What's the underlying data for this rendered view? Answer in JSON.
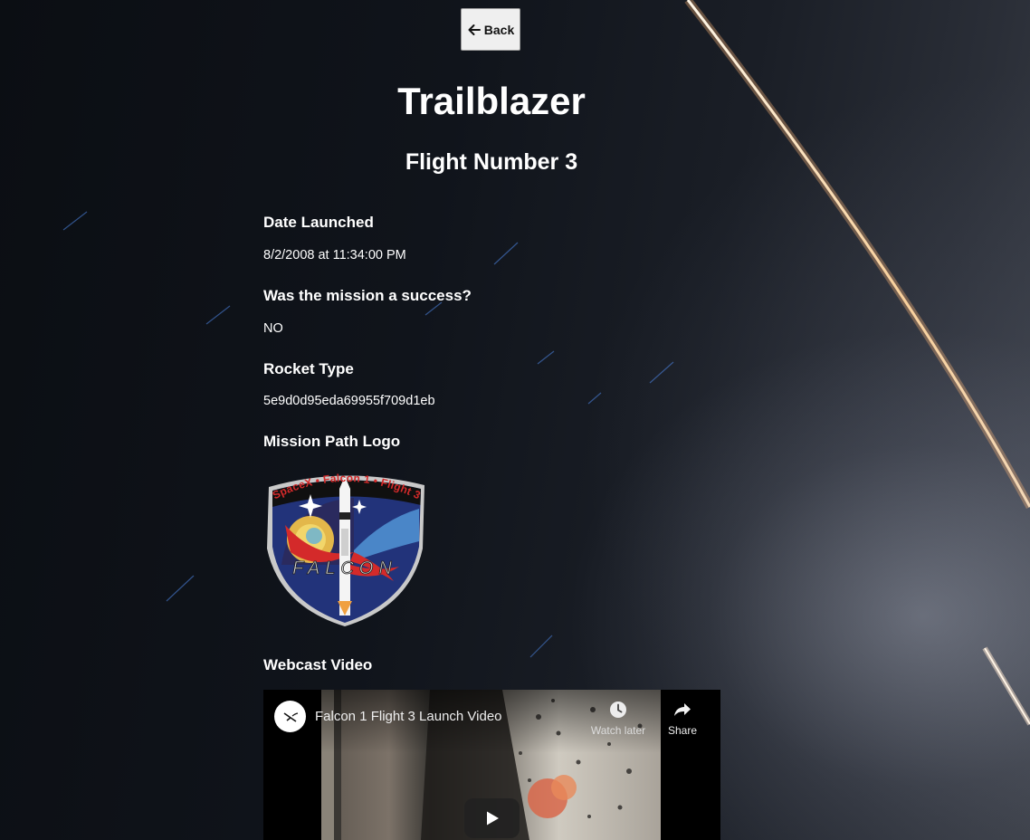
{
  "nav": {
    "back_label": "Back"
  },
  "mission": {
    "name": "Trailblazer",
    "flight_number": "Flight Number 3"
  },
  "details": {
    "date_label": "Date Launched",
    "date_value": "8/2/2008 at 11:34:00 PM",
    "success_label": "Was the mission a success?",
    "success_value": "NO",
    "rocket_label": "Rocket Type",
    "rocket_value": "5e9d0d95eda69955f709d1eb",
    "logo_label": "Mission Path Logo",
    "video_label": "Webcast Video"
  },
  "patch": {
    "arc_text": "SpaceX • Falcon 1 • Flight 3",
    "word": "FALCON"
  },
  "video": {
    "title": "Falcon 1 Flight 3 Launch Video",
    "watch_later_label": "Watch later",
    "share_label": "Share"
  },
  "icons": {
    "back": "arrow-left-icon",
    "channel": "spacex-logo-icon",
    "watch_later": "clock-icon",
    "share": "share-arrow-icon",
    "play": "play-icon"
  },
  "colors": {
    "text": "#ffffff",
    "button_bg": "#efefef",
    "patch_blue": "#2a3f8f",
    "patch_red": "#d42a2a"
  }
}
